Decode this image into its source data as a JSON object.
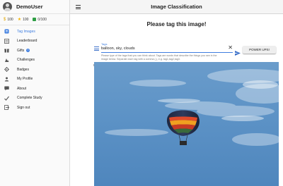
{
  "sidebar": {
    "username": "DemoUser",
    "stats": {
      "coins": "100",
      "stars": "100",
      "progress": "0/100"
    },
    "items": [
      {
        "label": "Tag Images",
        "icon": "tag-icon",
        "active": true
      },
      {
        "label": "Leaderboard",
        "icon": "leaderboard-icon"
      },
      {
        "label": "Gifts",
        "icon": "gift-icon"
      },
      {
        "label": "Challenges",
        "icon": "challenges-icon"
      },
      {
        "label": "Badges",
        "icon": "badge-icon"
      },
      {
        "label": "My Profile",
        "icon": "person-icon"
      },
      {
        "label": "About",
        "icon": "chat-icon"
      },
      {
        "label": "Complete Study",
        "icon": "checkmark-icon"
      },
      {
        "label": "Sign out",
        "icon": "sign-out-icon"
      }
    ]
  },
  "topbar": {
    "title": "Image Classification"
  },
  "main": {
    "prompt": "Please tag this image!",
    "tag_field": {
      "label": "Tags",
      "value": "balloon, sky, clouds"
    },
    "power_ups_label": "POWER UPS!",
    "helper_text": "Please type of the tags that you can think about. Tags are words that describe the things you see in the image below. Separate each tag with a comma (,), e.g. tag1,tag2,tag3.",
    "note_before": "Note: When you are ready to complete the study, please proceed to the ",
    "note_link": "final questionnaire",
    "note_after": ". We can only use the data you provided after you complete it."
  },
  "colors": {
    "accent": "#3f7ee0",
    "sky": "#5c93c6"
  }
}
